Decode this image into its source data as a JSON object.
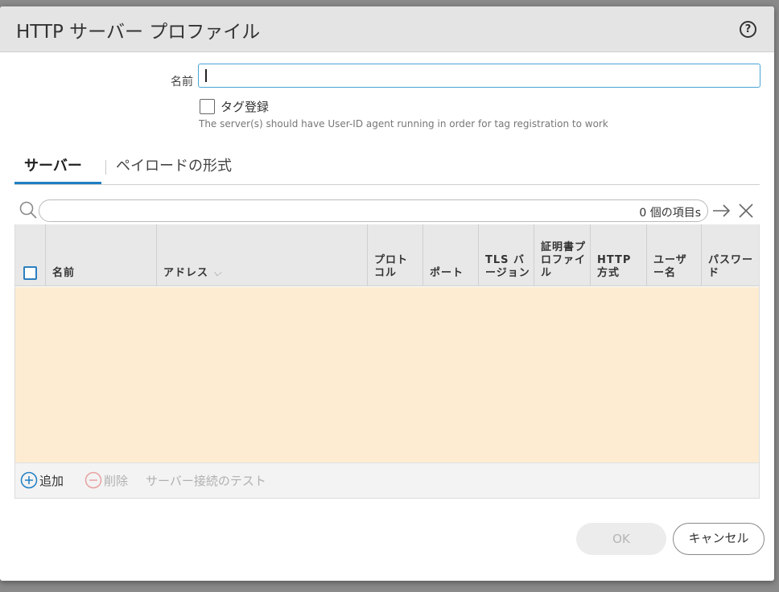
{
  "dialog": {
    "title": "HTTP サーバー プロファイル",
    "help_symbol": "?"
  },
  "form": {
    "name_label": "名前",
    "name_value": "",
    "tag_label": "タグ登録",
    "tag_checked": false,
    "note": "The server(s) should have User-ID agent running in order for tag registration to work"
  },
  "tabs": [
    {
      "label": "サーバー",
      "active": true
    },
    {
      "label": "ペイロードの形式",
      "active": false
    }
  ],
  "search": {
    "placeholder": "",
    "count": "0 個の項目s"
  },
  "table": {
    "columns": [
      {
        "label": "名前"
      },
      {
        "label": "アドレス",
        "sort_indicator": "⌵"
      },
      {
        "label": "プロトコル"
      },
      {
        "label": "ポート"
      },
      {
        "label": "TLS バージョン"
      },
      {
        "label": "証明書プロファイル"
      },
      {
        "label": "HTTP 方式"
      },
      {
        "label": "ユーザー名"
      },
      {
        "label": "パスワード"
      }
    ],
    "rows": []
  },
  "footer": {
    "add": "追加",
    "delete": "削除",
    "test": "サーバー接続のテスト"
  },
  "buttons": {
    "ok": "OK",
    "cancel": "キャンセル"
  },
  "colors": {
    "accent": "#1e7fc4",
    "empty_table_bg": "#fdecd1",
    "header_bg": "#e4e4e4"
  }
}
